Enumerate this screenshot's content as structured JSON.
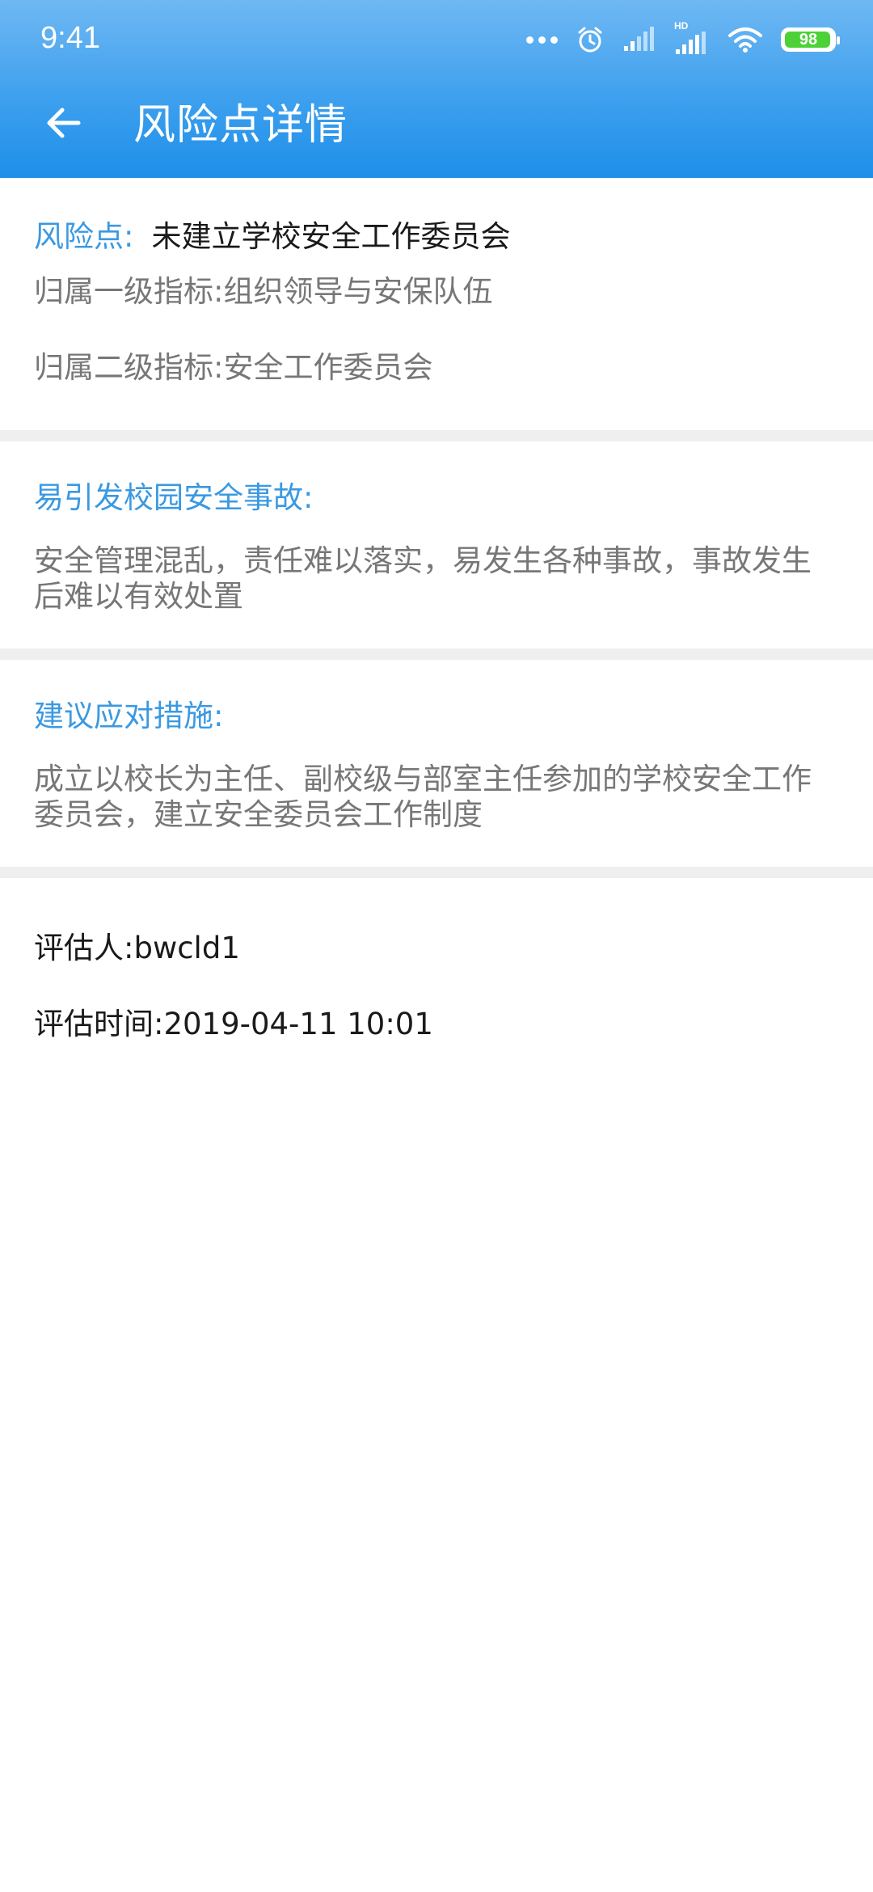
{
  "status_bar": {
    "time": "9:41",
    "hd_label": "HD",
    "battery": "98",
    "icons": [
      "more-dots-icon",
      "alarm-icon",
      "signal-icon",
      "hd-signal-icon",
      "wifi-icon",
      "battery-icon"
    ]
  },
  "header": {
    "title": "风险点详情",
    "back_icon": "arrow-left-icon"
  },
  "risk": {
    "label": "风险点:",
    "value": "未建立学校安全工作委员会",
    "level1": "归属一级指标:组织领导与安保队伍",
    "level2": "归属二级指标:安全工作委员会"
  },
  "accident": {
    "heading": "易引发校园安全事故:",
    "body": "安全管理混乱，责任难以落实，易发生各种事故，事故发生后难以有效处置"
  },
  "measures": {
    "heading": "建议应对措施:",
    "body": "成立以校长为主任、副校级与部室主任参加的学校安全工作委员会，建立安全委员会工作制度"
  },
  "assessment": {
    "assessor": "评估人:bwcld1",
    "time": "评估时间:2019-04-11 10:01"
  },
  "colors": {
    "accent": "#3a99e2",
    "appbar_top": "#6fb8f3",
    "appbar_bottom": "#1e8fe9",
    "gray_text": "#777777",
    "divider": "#efefef",
    "battery_fill": "#4cd137"
  }
}
